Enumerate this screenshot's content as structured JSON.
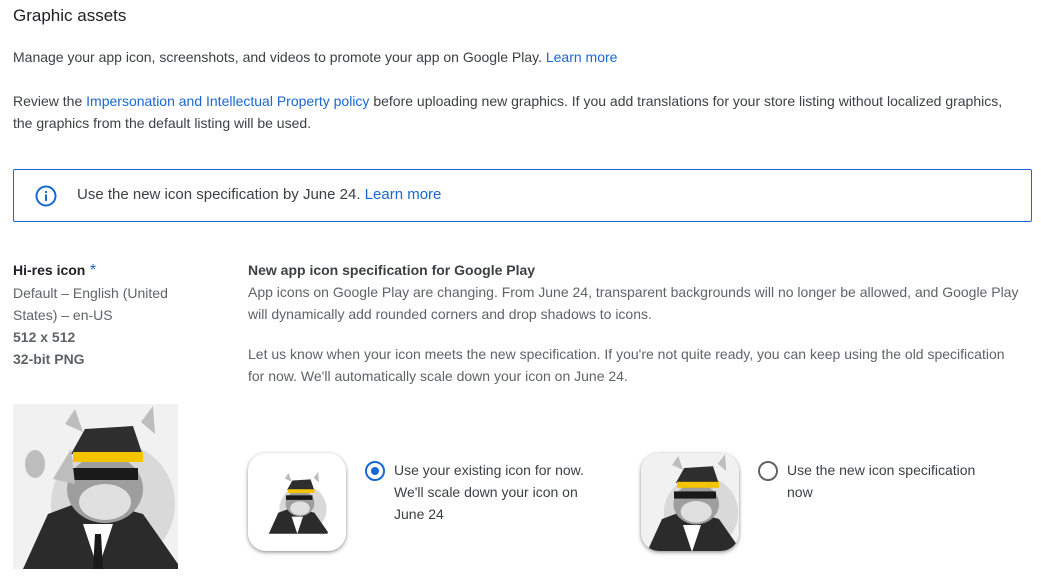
{
  "section": {
    "title": "Graphic assets",
    "intro_text": "Manage your app icon, screenshots, and videos to promote your app on Google Play.",
    "intro_link": "Learn more",
    "review_prefix": "Review the",
    "review_link": "Impersonation and Intellectual Property policy",
    "review_suffix": "before uploading new graphics. If you add translations for your store listing without localized graphics,",
    "review_line2": "the graphics from the default listing will be used."
  },
  "banner": {
    "icon": "info-icon",
    "text": "Use the new icon specification by June 24.",
    "link": "Learn more",
    "accent_color": "#1967d2"
  },
  "hires": {
    "label": "Hi-res icon",
    "required_mark": "*",
    "locale_line1": "Default – English (United",
    "locale_line2": "States) – en-US",
    "size": "512 x 512",
    "format": "32-bit PNG"
  },
  "spec": {
    "heading": "New app icon specification for Google Play",
    "p1_line1": "App icons on Google Play are changing. From June 24, transparent backgrounds will no longer be allowed, and Google Play",
    "p1_line2": "will dynamically add rounded corners and drop shadows to icons.",
    "p2_line1": "Let us know when your icon meets the new specification. If you're not quite ready, you can keep using the old specification",
    "p2_line2": "for now. We'll automatically scale down your icon on June 24."
  },
  "options": [
    {
      "line1": "Use your existing icon for now.",
      "line2": "We'll scale down your icon on",
      "line3": "June 24",
      "selected": true
    },
    {
      "line1": "Use the new icon specification",
      "line2": "now",
      "line3": "",
      "selected": false
    }
  ]
}
